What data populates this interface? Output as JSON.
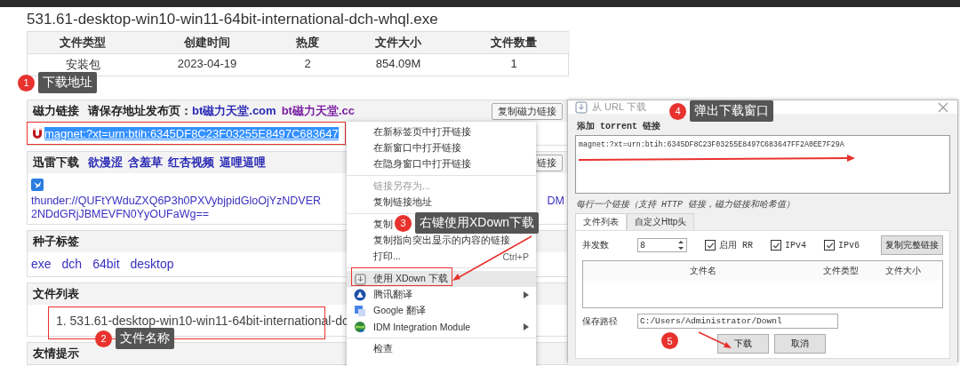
{
  "page": {
    "title": "531.61-desktop-win10-win11-64bit-international-dch-whql.exe",
    "info_table": {
      "columns": [
        "文件类型",
        "创建时间",
        "热度",
        "文件大小",
        "文件数量"
      ],
      "rows": [
        [
          "安装包",
          "2023-04-19",
          "2",
          "854.09M",
          "1"
        ]
      ]
    },
    "magnet_section": {
      "label": "磁力链接",
      "notice": "请保存地址发布页：",
      "links": [
        {
          "text": "bt磁力天堂.com",
          "visited": false
        },
        {
          "text": "bt磁力天堂.cc",
          "visited": true
        }
      ],
      "copy_button": "复制磁力链接",
      "link": "magnet:?xt=urn:btih:6345DF8C23F03255E8497C683647",
      "link_highlighted": true
    },
    "thunder_section": {
      "label": "迅雷下载",
      "links": [
        {
          "text": "欲漫涩",
          "visited": false
        },
        {
          "text": "含羞草",
          "visited": false
        },
        {
          "text": "红杏视频",
          "visited": false
        },
        {
          "text": "逼哩逼哩",
          "visited": false
        }
      ],
      "copy_button": "链接",
      "link_line_1": "thunder://QUFtYWduZXQ6P3h0PXVybjpidGloOjYzNDVER",
      "link_line_1_end": "DM",
      "link_line_2": "2NDdGRjJBMEVFN0YyOUFaWg=="
    },
    "tags_section": {
      "label": "种子标签",
      "tags": [
        "exe",
        "dch",
        "64bit",
        "desktop"
      ]
    },
    "file_list_section": {
      "label": "文件列表",
      "items": [
        "1. 531.61-desktop-win10-win11-64bit-international-dc"
      ]
    },
    "tips_section": {
      "label": "友情提示"
    }
  },
  "context_menu": {
    "items": [
      {
        "kind": "item",
        "label": "在新标签页中打开链接",
        "disabled": false,
        "selected": false
      },
      {
        "kind": "item",
        "label": "在新窗口中打开链接",
        "disabled": false,
        "selected": false
      },
      {
        "kind": "item",
        "label": "在隐身窗口中打开链接",
        "disabled": false,
        "selected": false
      },
      {
        "kind": "separator"
      },
      {
        "kind": "item",
        "label": "链接另存为...",
        "disabled": true,
        "selected": false
      },
      {
        "kind": "item",
        "label": "复制链接地址",
        "disabled": false,
        "selected": false
      },
      {
        "kind": "separator"
      },
      {
        "kind": "item",
        "label": "复制",
        "disabled": false,
        "selected": false
      },
      {
        "kind": "item",
        "label": "复制指向突出显示的内容的链接",
        "disabled": false,
        "selected": false
      },
      {
        "kind": "item",
        "label": "打印...",
        "shortcut": "Ctrl+P",
        "disabled": false,
        "selected": false
      },
      {
        "kind": "separator"
      },
      {
        "kind": "item",
        "label": "使用 XDown 下载",
        "disabled": false,
        "selected": true
      },
      {
        "kind": "item",
        "label": "腾讯翻译",
        "submenu": true,
        "disabled": false,
        "selected": false
      },
      {
        "kind": "item",
        "label": "Google 翻译",
        "disabled": false,
        "selected": false
      },
      {
        "kind": "item",
        "label": "IDM Integration Module",
        "submenu": true,
        "disabled": false,
        "selected": false
      },
      {
        "kind": "separator"
      },
      {
        "kind": "item",
        "label": "检查",
        "disabled": false,
        "selected": false
      }
    ]
  },
  "dialog": {
    "title": "从 URL 下载",
    "section_label": "添加 torrent 链接",
    "links_value": "magnet:?xt=urn:btih:6345DF8C23F03255E8497C683647FF2A0EE7F29A",
    "hint": "每行一个链接（支持 HTTP 链接，磁力链接和哈希值）",
    "tabs": [
      {
        "label": "文件列表",
        "selected": true
      },
      {
        "label": "自定义Http头",
        "selected": false
      }
    ],
    "concurrency_label": "并发数",
    "concurrency_value": "8",
    "checkboxes": [
      {
        "label": "启用 RR",
        "checked": true
      },
      {
        "label": "IPv4",
        "checked": true
      },
      {
        "label": "IPv6",
        "checked": true
      }
    ],
    "copy_button": "复制完整链接",
    "columns": [
      "文件名",
      "文件类型",
      "文件大小"
    ],
    "save_path_label": "保存路径",
    "save_path_value": "C:/Users/Administrator/Downl",
    "buttons": [
      "下载",
      "取消"
    ]
  },
  "callouts": [
    {
      "number": "1",
      "text": "下载地址"
    },
    {
      "number": "2",
      "text": "文件名称"
    },
    {
      "number": "3",
      "text": "右键使用XDown下载"
    },
    {
      "number": "4",
      "text": "弹出下载窗口"
    },
    {
      "number": "5"
    }
  ]
}
